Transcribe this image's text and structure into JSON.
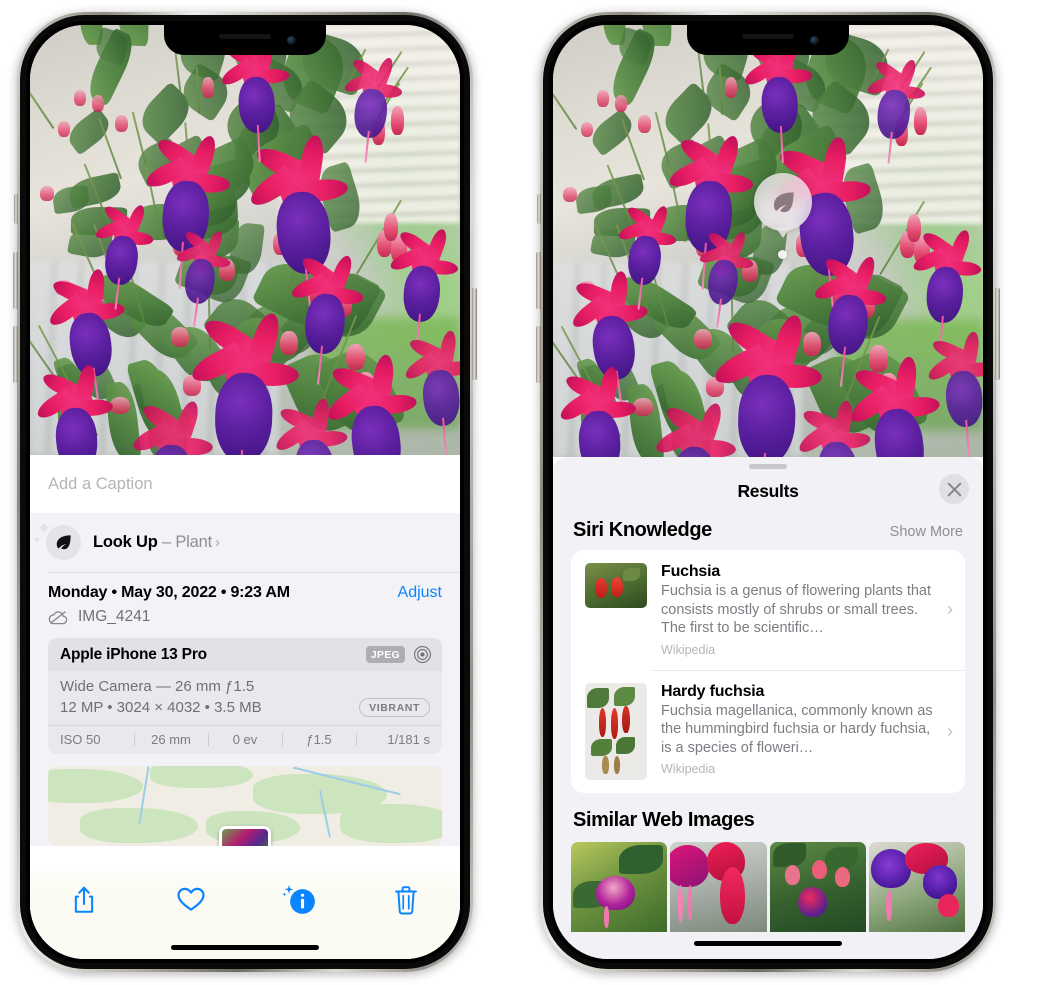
{
  "left_phone": {
    "caption_placeholder": "Add a Caption",
    "lookup": {
      "label": "Look Up",
      "dash": " – ",
      "subject": "Plant",
      "chevron": "›",
      "icon": "leaf-icon"
    },
    "meta": {
      "date": "Monday • May 30, 2022 • 9:23 AM",
      "adjust_label": "Adjust",
      "filename": "IMG_4241",
      "cloud_icon": "cloud-slash-icon"
    },
    "camera": {
      "device": "Apple iPhone 13 Pro",
      "format_badge": "JPEG",
      "aperture_icon": "aperture-icon",
      "lens_line": "Wide Camera — 26 mm ƒ1.5",
      "specs_line": "12 MP • 3024 × 4032 • 3.5 MB",
      "style_badge": "VIBRANT",
      "exif": [
        "ISO 50",
        "26 mm",
        "0 ev",
        "ƒ1.5",
        "1/181 s"
      ]
    },
    "toolbar": [
      {
        "name": "share-icon",
        "label": "Share"
      },
      {
        "name": "heart-icon",
        "label": "Favorite"
      },
      {
        "name": "info-sparkle-icon",
        "label": "Info"
      },
      {
        "name": "trash-icon",
        "label": "Delete"
      }
    ]
  },
  "right_phone": {
    "badge": {
      "icon": "leaf-icon",
      "label": "Visual Look Up"
    },
    "sheet": {
      "title": "Results",
      "close_icon": "close-icon",
      "sections": [
        {
          "title": "Siri Knowledge",
          "action": "Show More",
          "items": [
            {
              "title": "Fuchsia",
              "desc": "Fuchsia is a genus of flowering plants that consists mostly of shrubs or small trees. The first to be scientific…",
              "source": "Wikipedia",
              "chevron": "›"
            },
            {
              "title": "Hardy fuchsia",
              "desc": "Fuchsia magellanica, commonly known as the hummingbird fuchsia or hardy fuchsia, is a species of floweri…",
              "source": "Wikipedia",
              "chevron": "›"
            }
          ]
        },
        {
          "title": "Similar Web Images",
          "thumbnails": [
            "fuchsia-pink-white-bloom",
            "fuchsia-red-closeup",
            "fuchsia-bush-buds",
            "fuchsia-purple-cluster"
          ]
        }
      ]
    }
  },
  "colors": {
    "accent_blue": "#0a84ff",
    "panel_bg": "#f2f1f6",
    "card_bg": "#ffffff",
    "secondary_text": "#8e8e93"
  }
}
